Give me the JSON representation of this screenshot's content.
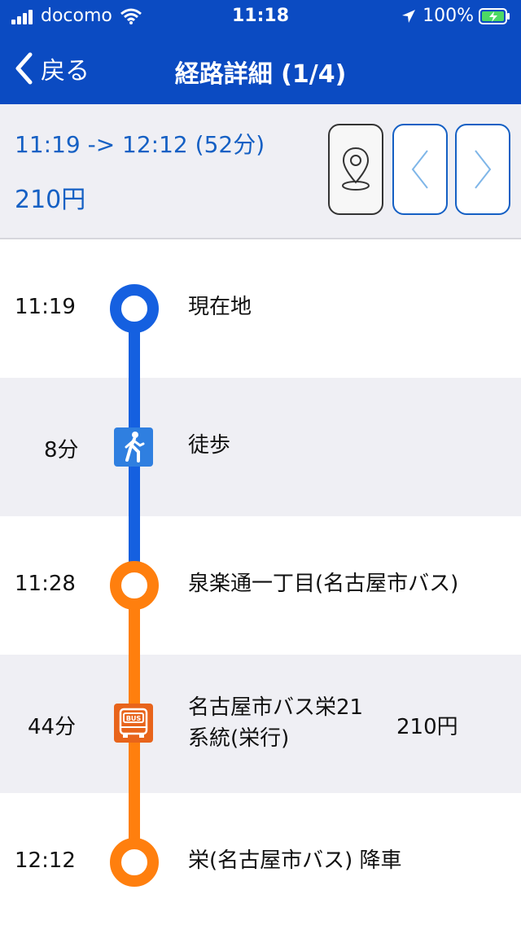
{
  "status_bar": {
    "carrier": "docomo",
    "time": "11:18",
    "battery": "100%"
  },
  "nav": {
    "back_label": "戻る",
    "title": "経路詳細 (1/4)"
  },
  "summary": {
    "time_range": "11:19 -> 12:12 (52分)",
    "fare": "210円"
  },
  "colors": {
    "header_blue": "#0b4bc2",
    "walk_line": "#1560e0",
    "bus_line": "#ff7f0e",
    "bus_icon": "#e8641b",
    "walk_icon": "#2f7fe0"
  },
  "timeline": [
    {
      "type": "stop",
      "time": "11:19",
      "name": "現在地",
      "color": "#1560e0"
    },
    {
      "type": "segment",
      "duration": "8分",
      "mode_icon": "walk-icon",
      "name": "徒歩"
    },
    {
      "type": "stop",
      "time": "11:28",
      "name": "泉楽通一丁目(名古屋市バス)",
      "color": "#ff7f0e"
    },
    {
      "type": "segment",
      "duration": "44分",
      "mode_icon": "bus-icon",
      "name_line1": "名古屋市バス栄21",
      "name_line2": "系統(栄行)",
      "fare": "210円"
    },
    {
      "type": "stop",
      "time": "12:12",
      "name": "栄(名古屋市バス) 降車",
      "color": "#ff7f0e"
    }
  ]
}
